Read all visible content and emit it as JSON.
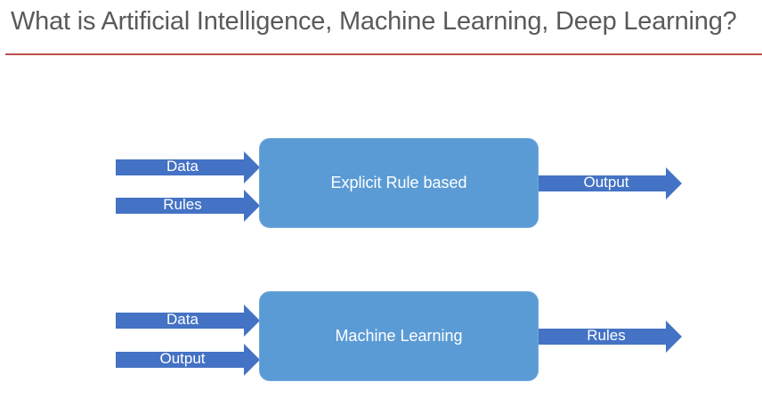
{
  "title": "What is Artificial Intelligence, Machine Learning, Deep Learning?",
  "colors": {
    "title_rule": "#c0504d",
    "box_fill": "#5b9bd5",
    "arrow_fill": "#4472c4"
  },
  "diagram1": {
    "inputs": [
      "Data",
      "Rules"
    ],
    "box": "Explicit Rule based",
    "output": "Output"
  },
  "diagram2": {
    "inputs": [
      "Data",
      "Output"
    ],
    "box": "Machine Learning",
    "output": "Rules"
  }
}
